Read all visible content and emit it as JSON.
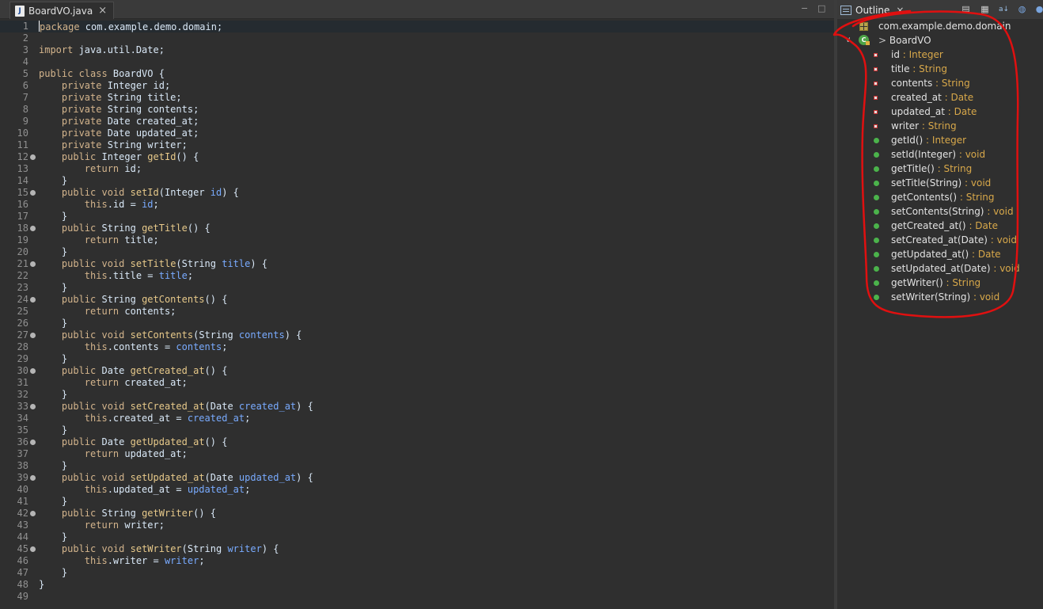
{
  "editor": {
    "tab_label": "BoardVO.java",
    "tab_close": "×",
    "minimize": "−",
    "maximize": "□"
  },
  "code_lines": [
    {
      "n": "1",
      "m": false,
      "t": [
        [
          "kw",
          "package"
        ],
        [
          "plain",
          " com.example.demo.domain;"
        ]
      ]
    },
    {
      "n": "2",
      "m": false,
      "t": []
    },
    {
      "n": "3",
      "m": false,
      "t": [
        [
          "kw",
          "import"
        ],
        [
          "plain",
          " java.util.Date;"
        ]
      ]
    },
    {
      "n": "4",
      "m": false,
      "t": []
    },
    {
      "n": "5",
      "m": false,
      "t": [
        [
          "kw",
          "public class"
        ],
        [
          "plain",
          " BoardVO {"
        ]
      ]
    },
    {
      "n": "6",
      "m": false,
      "t": [
        [
          "plain",
          "    "
        ],
        [
          "kw",
          "private"
        ],
        [
          "plain",
          " Integer id;"
        ]
      ]
    },
    {
      "n": "7",
      "m": false,
      "t": [
        [
          "plain",
          "    "
        ],
        [
          "kw",
          "private"
        ],
        [
          "plain",
          " String title;"
        ]
      ]
    },
    {
      "n": "8",
      "m": false,
      "t": [
        [
          "plain",
          "    "
        ],
        [
          "kw",
          "private"
        ],
        [
          "plain",
          " String contents;"
        ]
      ]
    },
    {
      "n": "9",
      "m": false,
      "t": [
        [
          "plain",
          "    "
        ],
        [
          "kw",
          "private"
        ],
        [
          "plain",
          " Date created_at;"
        ]
      ]
    },
    {
      "n": "10",
      "m": false,
      "t": [
        [
          "plain",
          "    "
        ],
        [
          "kw",
          "private"
        ],
        [
          "plain",
          " Date updated_at;"
        ]
      ]
    },
    {
      "n": "11",
      "m": false,
      "t": [
        [
          "plain",
          "    "
        ],
        [
          "kw",
          "private"
        ],
        [
          "plain",
          " String writer;"
        ]
      ]
    },
    {
      "n": "12",
      "m": true,
      "t": [
        [
          "plain",
          "    "
        ],
        [
          "kw",
          "public"
        ],
        [
          "plain",
          " Integer "
        ],
        [
          "mname",
          "getId"
        ],
        [
          "plain",
          "() {"
        ]
      ]
    },
    {
      "n": "13",
      "m": false,
      "t": [
        [
          "plain",
          "        "
        ],
        [
          "kw",
          "return"
        ],
        [
          "plain",
          " id;"
        ]
      ]
    },
    {
      "n": "14",
      "m": false,
      "t": [
        [
          "plain",
          "    }"
        ]
      ]
    },
    {
      "n": "15",
      "m": true,
      "t": [
        [
          "plain",
          "    "
        ],
        [
          "kw",
          "public void"
        ],
        [
          "plain",
          " "
        ],
        [
          "mname",
          "setId"
        ],
        [
          "plain",
          "(Integer "
        ],
        [
          "param",
          "id"
        ],
        [
          "plain",
          ") {"
        ]
      ]
    },
    {
      "n": "16",
      "m": false,
      "t": [
        [
          "plain",
          "        "
        ],
        [
          "kw",
          "this"
        ],
        [
          "plain",
          ".id = "
        ],
        [
          "param",
          "id"
        ],
        [
          "plain",
          ";"
        ]
      ]
    },
    {
      "n": "17",
      "m": false,
      "t": [
        [
          "plain",
          "    }"
        ]
      ]
    },
    {
      "n": "18",
      "m": true,
      "t": [
        [
          "plain",
          "    "
        ],
        [
          "kw",
          "public"
        ],
        [
          "plain",
          " String "
        ],
        [
          "mname",
          "getTitle"
        ],
        [
          "plain",
          "() {"
        ]
      ]
    },
    {
      "n": "19",
      "m": false,
      "t": [
        [
          "plain",
          "        "
        ],
        [
          "kw",
          "return"
        ],
        [
          "plain",
          " title;"
        ]
      ]
    },
    {
      "n": "20",
      "m": false,
      "t": [
        [
          "plain",
          "    }"
        ]
      ]
    },
    {
      "n": "21",
      "m": true,
      "t": [
        [
          "plain",
          "    "
        ],
        [
          "kw",
          "public void"
        ],
        [
          "plain",
          " "
        ],
        [
          "mname",
          "setTitle"
        ],
        [
          "plain",
          "(String "
        ],
        [
          "param",
          "title"
        ],
        [
          "plain",
          ") {"
        ]
      ]
    },
    {
      "n": "22",
      "m": false,
      "t": [
        [
          "plain",
          "        "
        ],
        [
          "kw",
          "this"
        ],
        [
          "plain",
          ".title = "
        ],
        [
          "param",
          "title"
        ],
        [
          "plain",
          ";"
        ]
      ]
    },
    {
      "n": "23",
      "m": false,
      "t": [
        [
          "plain",
          "    }"
        ]
      ]
    },
    {
      "n": "24",
      "m": true,
      "t": [
        [
          "plain",
          "    "
        ],
        [
          "kw",
          "public"
        ],
        [
          "plain",
          " String "
        ],
        [
          "mname",
          "getContents"
        ],
        [
          "plain",
          "() {"
        ]
      ]
    },
    {
      "n": "25",
      "m": false,
      "t": [
        [
          "plain",
          "        "
        ],
        [
          "kw",
          "return"
        ],
        [
          "plain",
          " contents;"
        ]
      ]
    },
    {
      "n": "26",
      "m": false,
      "t": [
        [
          "plain",
          "    }"
        ]
      ]
    },
    {
      "n": "27",
      "m": true,
      "t": [
        [
          "plain",
          "    "
        ],
        [
          "kw",
          "public void"
        ],
        [
          "plain",
          " "
        ],
        [
          "mname",
          "setContents"
        ],
        [
          "plain",
          "(String "
        ],
        [
          "param",
          "contents"
        ],
        [
          "plain",
          ") {"
        ]
      ]
    },
    {
      "n": "28",
      "m": false,
      "t": [
        [
          "plain",
          "        "
        ],
        [
          "kw",
          "this"
        ],
        [
          "plain",
          ".contents = "
        ],
        [
          "param",
          "contents"
        ],
        [
          "plain",
          ";"
        ]
      ]
    },
    {
      "n": "29",
      "m": false,
      "t": [
        [
          "plain",
          "    }"
        ]
      ]
    },
    {
      "n": "30",
      "m": true,
      "t": [
        [
          "plain",
          "    "
        ],
        [
          "kw",
          "public"
        ],
        [
          "plain",
          " Date "
        ],
        [
          "mname",
          "getCreated_at"
        ],
        [
          "plain",
          "() {"
        ]
      ]
    },
    {
      "n": "31",
      "m": false,
      "t": [
        [
          "plain",
          "        "
        ],
        [
          "kw",
          "return"
        ],
        [
          "plain",
          " created_at;"
        ]
      ]
    },
    {
      "n": "32",
      "m": false,
      "t": [
        [
          "plain",
          "    }"
        ]
      ]
    },
    {
      "n": "33",
      "m": true,
      "t": [
        [
          "plain",
          "    "
        ],
        [
          "kw",
          "public void"
        ],
        [
          "plain",
          " "
        ],
        [
          "mname",
          "setCreated_at"
        ],
        [
          "plain",
          "(Date "
        ],
        [
          "param",
          "created_at"
        ],
        [
          "plain",
          ") {"
        ]
      ]
    },
    {
      "n": "34",
      "m": false,
      "t": [
        [
          "plain",
          "        "
        ],
        [
          "kw",
          "this"
        ],
        [
          "plain",
          ".created_at = "
        ],
        [
          "param",
          "created_at"
        ],
        [
          "plain",
          ";"
        ]
      ]
    },
    {
      "n": "35",
      "m": false,
      "t": [
        [
          "plain",
          "    }"
        ]
      ]
    },
    {
      "n": "36",
      "m": true,
      "t": [
        [
          "plain",
          "    "
        ],
        [
          "kw",
          "public"
        ],
        [
          "plain",
          " Date "
        ],
        [
          "mname",
          "getUpdated_at"
        ],
        [
          "plain",
          "() {"
        ]
      ]
    },
    {
      "n": "37",
      "m": false,
      "t": [
        [
          "plain",
          "        "
        ],
        [
          "kw",
          "return"
        ],
        [
          "plain",
          " updated_at;"
        ]
      ]
    },
    {
      "n": "38",
      "m": false,
      "t": [
        [
          "plain",
          "    }"
        ]
      ]
    },
    {
      "n": "39",
      "m": true,
      "t": [
        [
          "plain",
          "    "
        ],
        [
          "kw",
          "public void"
        ],
        [
          "plain",
          " "
        ],
        [
          "mname",
          "setUpdated_at"
        ],
        [
          "plain",
          "(Date "
        ],
        [
          "param",
          "updated_at"
        ],
        [
          "plain",
          ") {"
        ]
      ]
    },
    {
      "n": "40",
      "m": false,
      "t": [
        [
          "plain",
          "        "
        ],
        [
          "kw",
          "this"
        ],
        [
          "plain",
          ".updated_at = "
        ],
        [
          "param",
          "updated_at"
        ],
        [
          "plain",
          ";"
        ]
      ]
    },
    {
      "n": "41",
      "m": false,
      "t": [
        [
          "plain",
          "    }"
        ]
      ]
    },
    {
      "n": "42",
      "m": true,
      "t": [
        [
          "plain",
          "    "
        ],
        [
          "kw",
          "public"
        ],
        [
          "plain",
          " String "
        ],
        [
          "mname",
          "getWriter"
        ],
        [
          "plain",
          "() {"
        ]
      ]
    },
    {
      "n": "43",
      "m": false,
      "t": [
        [
          "plain",
          "        "
        ],
        [
          "kw",
          "return"
        ],
        [
          "plain",
          " writer;"
        ]
      ]
    },
    {
      "n": "44",
      "m": false,
      "t": [
        [
          "plain",
          "    }"
        ]
      ]
    },
    {
      "n": "45",
      "m": true,
      "t": [
        [
          "plain",
          "    "
        ],
        [
          "kw",
          "public void"
        ],
        [
          "plain",
          " "
        ],
        [
          "mname",
          "setWriter"
        ],
        [
          "plain",
          "(String "
        ],
        [
          "param",
          "writer"
        ],
        [
          "plain",
          ") {"
        ]
      ]
    },
    {
      "n": "46",
      "m": false,
      "t": [
        [
          "plain",
          "        "
        ],
        [
          "kw",
          "this"
        ],
        [
          "plain",
          ".writer = "
        ],
        [
          "param",
          "writer"
        ],
        [
          "plain",
          ";"
        ]
      ]
    },
    {
      "n": "47",
      "m": false,
      "t": [
        [
          "plain",
          "    }"
        ]
      ]
    },
    {
      "n": "48",
      "m": false,
      "t": [
        [
          "plain",
          "}"
        ]
      ]
    },
    {
      "n": "49",
      "m": false,
      "t": []
    }
  ],
  "outline": {
    "tab_label": "Outline",
    "tab_close": "×",
    "toolbar_icons": [
      "collapse-all-icon",
      "hide-fields-icon",
      "sort-az-icon",
      "hide-static-icon",
      "hide-nonpublic-icon"
    ],
    "package_name": "com.example.demo.domain",
    "class_prefix": ">",
    "class_name": "BoardVO",
    "class_icon_letter": "C",
    "members": [
      {
        "kind": "field",
        "name": "id",
        "type": " : Integer"
      },
      {
        "kind": "field",
        "name": "title",
        "type": " : String"
      },
      {
        "kind": "field",
        "name": "contents",
        "type": " : String"
      },
      {
        "kind": "field",
        "name": "created_at",
        "type": " : Date"
      },
      {
        "kind": "field",
        "name": "updated_at",
        "type": " : Date"
      },
      {
        "kind": "field",
        "name": "writer",
        "type": " : String"
      },
      {
        "kind": "method",
        "name": "getId()",
        "type": " : Integer"
      },
      {
        "kind": "method",
        "name": "setId(Integer)",
        "type": " : void"
      },
      {
        "kind": "method",
        "name": "getTitle()",
        "type": " : String"
      },
      {
        "kind": "method",
        "name": "setTitle(String)",
        "type": " : void"
      },
      {
        "kind": "method",
        "name": "getContents()",
        "type": " : String"
      },
      {
        "kind": "method",
        "name": "setContents(String)",
        "type": " : void"
      },
      {
        "kind": "method",
        "name": "getCreated_at()",
        "type": " : Date"
      },
      {
        "kind": "method",
        "name": "setCreated_at(Date)",
        "type": " : void"
      },
      {
        "kind": "method",
        "name": "getUpdated_at()",
        "type": " : Date"
      },
      {
        "kind": "method",
        "name": "setUpdated_at(Date)",
        "type": " : void"
      },
      {
        "kind": "method",
        "name": "getWriter()",
        "type": " : String"
      },
      {
        "kind": "method",
        "name": "setWriter(String)",
        "type": " : void"
      }
    ]
  },
  "colors": {
    "background": "#2f2f2f",
    "keyword": "#d3b48c",
    "method_name": "#e7c98a",
    "parameter": "#79abff",
    "type_suffix": "#d8a84a",
    "annotation_red": "#e01010"
  }
}
